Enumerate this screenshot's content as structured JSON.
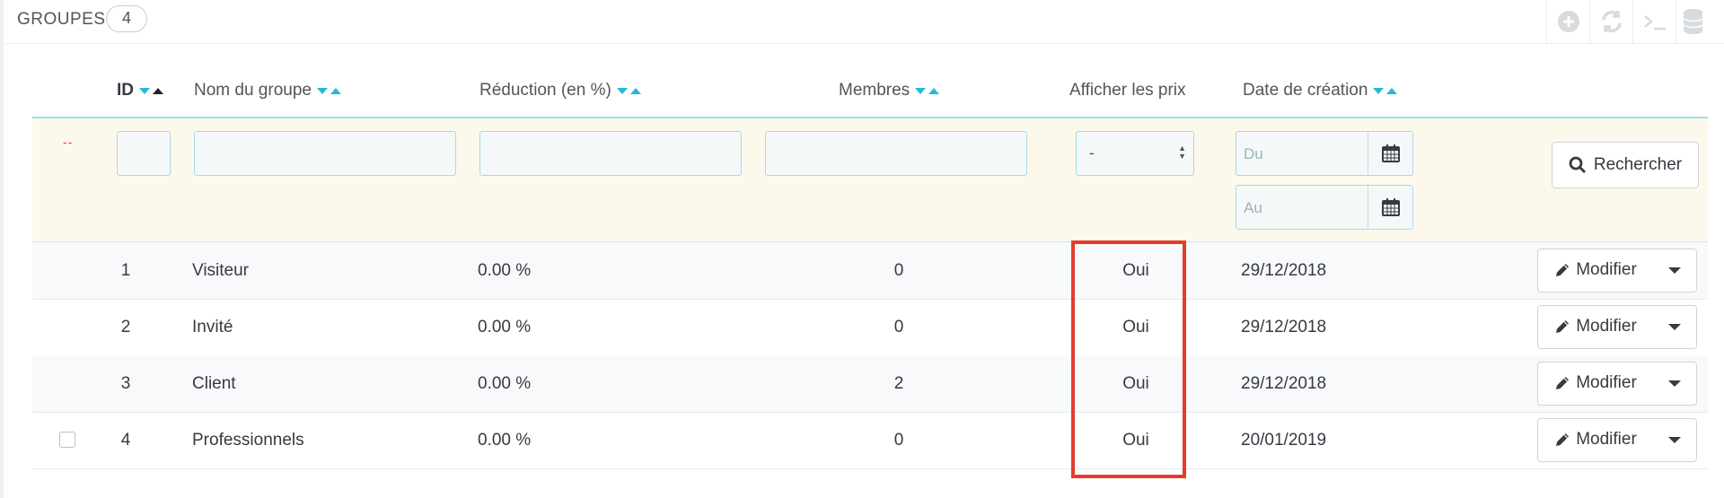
{
  "panel": {
    "title": "Groupes",
    "count": "4"
  },
  "toolbar": {
    "buttons": [
      {
        "name": "add-new-icon"
      },
      {
        "name": "refresh-icon"
      },
      {
        "name": "sql-query-icon"
      },
      {
        "name": "export-database-icon"
      }
    ]
  },
  "columns": {
    "id": "ID",
    "name": "Nom du groupe",
    "reduction": "Réduction (en %)",
    "members": "Membres",
    "show_prices": "Afficher les prix",
    "date": "Date de création"
  },
  "filters": {
    "bulk_marker": "--",
    "show_prices_value": "-",
    "date_from_placeholder": "Du",
    "date_to_placeholder": "Au",
    "search_label": "Rechercher"
  },
  "rows": [
    {
      "id": "1",
      "name": "Visiteur",
      "reduction": "0.00 %",
      "members": "0",
      "show_prices": "Oui",
      "date": "29/12/2018",
      "action": "Modifier"
    },
    {
      "id": "2",
      "name": "Invité",
      "reduction": "0.00 %",
      "members": "0",
      "show_prices": "Oui",
      "date": "29/12/2018",
      "action": "Modifier"
    },
    {
      "id": "3",
      "name": "Client",
      "reduction": "0.00 %",
      "members": "2",
      "show_prices": "Oui",
      "date": "29/12/2018",
      "action": "Modifier"
    },
    {
      "id": "4",
      "name": "Professionnels",
      "reduction": "0.00 %",
      "members": "0",
      "show_prices": "Oui",
      "date": "20/01/2019",
      "action": "Modifier",
      "selectable": true
    }
  ],
  "colors": {
    "accent": "#25b9d7",
    "highlight": "#e53b2c",
    "filter_bg": "#fcf9ec"
  }
}
